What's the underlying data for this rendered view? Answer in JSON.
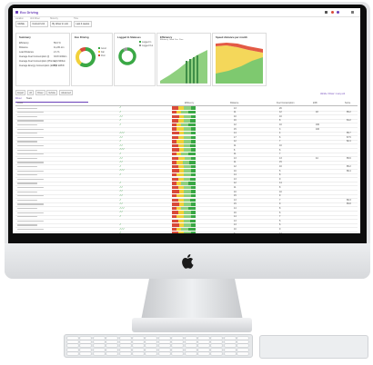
{
  "app": {
    "title": "Eco Driving",
    "topbar_icons": [
      "grid-icon",
      "bell-icon",
      "user-icon",
      "logout-icon"
    ]
  },
  "filters": [
    {
      "label": "Location",
      "value": "Mobile"
    },
    {
      "label": "Unit Driver",
      "value": "Current Unit"
    },
    {
      "label": "Show by",
      "value": "By driver in unit"
    },
    {
      "label": "Time",
      "value": "Last 4 weeks"
    }
  ],
  "summary": {
    "title": "Summary",
    "rows": [
      {
        "label": "Efficiency",
        "value": "59.0 %"
      },
      {
        "label": "Distance",
        "value": "11,231 km"
      },
      {
        "label": "Load Distance",
        "value": "2.1 %"
      },
      {
        "label": "Average Fuel Consumption (l)",
        "value": "33.8 l/100km"
      },
      {
        "label": "Average Fuel Consumption (l/Tonne)",
        "value": "1.0 l/100km"
      },
      {
        "label": "Average Energy Consumption (kWh)",
        "value": "159 kWh/h"
      }
    ]
  },
  "eco_driving_card": {
    "title": "Eco Driving",
    "legend": [
      "Good",
      "Fair",
      "Poor"
    ],
    "share": [
      0.6,
      0.3,
      0.1
    ]
  },
  "logged_in_card": {
    "title": "Logged In Statuses",
    "legend": [
      "Logged In",
      "Logged Out"
    ],
    "share": [
      0.92,
      0.08
    ]
  },
  "efficiency_card": {
    "title": "Efficiency",
    "legend": [
      "Efficiency",
      "Good",
      "Fair",
      "Poor"
    ]
  },
  "speed_card": {
    "title": "Speed distance per month"
  },
  "toolbar": {
    "buttons": [
      "Export",
      "All",
      "Driver",
      "Vehicle",
      "Advanced"
    ],
    "status_note": "Vehicle / Driver: in any unit"
  },
  "tabs": [
    "Driver",
    "Team"
  ],
  "table": {
    "headers": [
      "Driver",
      "Efficiency",
      "Distance",
      "Fuel Consumption",
      "kWh",
      "Score"
    ],
    "rows": [
      {
        "arrows": "↗",
        "distance": "13",
        "fuel": "26",
        "kwh": "",
        "score": "",
        "heat": [
          0.25,
          0.25,
          0.3,
          0.2
        ]
      },
      {
        "arrows": "↗",
        "distance": "11",
        "fuel": "12",
        "kwh": "18",
        "score": "85.2",
        "heat": [
          0.2,
          0.2,
          0.3,
          0.3
        ]
      },
      {
        "arrows": "↗↗",
        "distance": "10",
        "fuel": "10",
        "kwh": "",
        "score": "",
        "heat": [
          0.3,
          0.2,
          0.3,
          0.2
        ]
      },
      {
        "arrows": "↗",
        "distance": "16",
        "fuel": "8",
        "kwh": "",
        "score": "84.2",
        "heat": [
          0.25,
          0.25,
          0.25,
          0.25
        ]
      },
      {
        "arrows": "↗",
        "distance": "12",
        "fuel": "10",
        "kwh": "160",
        "score": "",
        "heat": [
          0.2,
          0.2,
          0.3,
          0.3
        ]
      },
      {
        "arrows": "",
        "distance": "15",
        "fuel": "3",
        "kwh": "100",
        "score": "",
        "heat": [
          0.2,
          0.3,
          0.3,
          0.2
        ]
      },
      {
        "arrows": "↗↗↗",
        "distance": "14",
        "fuel": "4",
        "kwh": "",
        "score": "85.7",
        "heat": [
          0.3,
          0.2,
          0.3,
          0.2
        ]
      },
      {
        "arrows": "↗↗",
        "distance": "17",
        "fuel": "6",
        "kwh": "",
        "score": "87.5",
        "heat": [
          0.25,
          0.25,
          0.3,
          0.2
        ]
      },
      {
        "arrows": "↗",
        "distance": "12",
        "fuel": "7",
        "kwh": "",
        "score": "82.4",
        "heat": [
          0.2,
          0.3,
          0.3,
          0.2
        ]
      },
      {
        "arrows": "↗↗",
        "distance": "11",
        "fuel": "10",
        "kwh": "",
        "score": "",
        "heat": [
          0.25,
          0.25,
          0.25,
          0.25
        ]
      },
      {
        "arrows": "↗↗↗",
        "distance": "8",
        "fuel": "6",
        "kwh": "",
        "score": "",
        "heat": [
          0.3,
          0.2,
          0.3,
          0.2
        ]
      },
      {
        "arrows": "↗",
        "distance": "11",
        "fuel": "7",
        "kwh": "",
        "score": "",
        "heat": [
          0.2,
          0.2,
          0.3,
          0.3
        ]
      },
      {
        "arrows": "↗↗",
        "distance": "13",
        "fuel": "13",
        "kwh": "44",
        "score": "85.6",
        "heat": [
          0.25,
          0.3,
          0.25,
          0.2
        ]
      },
      {
        "arrows": "↗↗",
        "distance": "11",
        "fuel": "15",
        "kwh": "",
        "score": "",
        "heat": [
          0.2,
          0.25,
          0.3,
          0.25
        ]
      },
      {
        "arrows": "↗",
        "distance": "12",
        "fuel": "10",
        "kwh": "",
        "score": "85.2",
        "heat": [
          0.25,
          0.25,
          0.3,
          0.2
        ]
      },
      {
        "arrows": "↗↗↗",
        "distance": "10",
        "fuel": "5",
        "kwh": "",
        "score": "86.4",
        "heat": [
          0.3,
          0.2,
          0.3,
          0.2
        ]
      },
      {
        "arrows": "↗",
        "distance": "14",
        "fuel": "8",
        "kwh": "",
        "score": "",
        "heat": [
          0.2,
          0.3,
          0.3,
          0.2
        ]
      },
      {
        "arrows": "",
        "distance": "13",
        "fuel": "9",
        "kwh": "",
        "score": "",
        "heat": [
          0.25,
          0.25,
          0.25,
          0.25
        ]
      },
      {
        "arrows": "↗",
        "distance": "12",
        "fuel": "14",
        "kwh": "",
        "score": "",
        "heat": [
          0.2,
          0.2,
          0.3,
          0.3
        ]
      },
      {
        "arrows": "↗↗",
        "distance": "11",
        "fuel": "8",
        "kwh": "",
        "score": "",
        "heat": [
          0.25,
          0.25,
          0.3,
          0.2
        ]
      },
      {
        "arrows": "↗↗",
        "distance": "10",
        "fuel": "10",
        "kwh": "",
        "score": "",
        "heat": [
          0.3,
          0.2,
          0.3,
          0.2
        ]
      },
      {
        "arrows": "↗↗",
        "distance": "15",
        "fuel": "9",
        "kwh": "",
        "score": "",
        "heat": [
          0.2,
          0.3,
          0.3,
          0.2
        ]
      },
      {
        "arrows": "↗",
        "distance": "13",
        "fuel": "7",
        "kwh": "",
        "score": "86.3",
        "heat": [
          0.25,
          0.25,
          0.25,
          0.25
        ]
      },
      {
        "arrows": "↗↗",
        "distance": "15",
        "fuel": "9",
        "kwh": "",
        "score": "85.8",
        "heat": [
          0.3,
          0.2,
          0.3,
          0.2
        ]
      },
      {
        "arrows": "↗↗↗",
        "distance": "14",
        "fuel": "8",
        "kwh": "",
        "score": "",
        "heat": [
          0.2,
          0.2,
          0.3,
          0.3
        ]
      },
      {
        "arrows": "↗↗",
        "distance": "16",
        "fuel": "6",
        "kwh": "",
        "score": "",
        "heat": [
          0.25,
          0.25,
          0.3,
          0.2
        ]
      },
      {
        "arrows": "↗",
        "distance": "14",
        "fuel": "7",
        "kwh": "",
        "score": "",
        "heat": [
          0.2,
          0.3,
          0.3,
          0.2
        ]
      },
      {
        "arrows": "",
        "distance": "13",
        "fuel": "5",
        "kwh": "",
        "score": "",
        "heat": [
          0.25,
          0.25,
          0.25,
          0.25
        ]
      },
      {
        "arrows": "↗",
        "distance": "13",
        "fuel": "6",
        "kwh": "",
        "score": "",
        "heat": [
          0.3,
          0.2,
          0.3,
          0.2
        ]
      },
      {
        "arrows": "↗↗↗",
        "distance": "10",
        "fuel": "9",
        "kwh": "",
        "score": "",
        "heat": [
          0.2,
          0.2,
          0.3,
          0.3
        ]
      },
      {
        "arrows": "↗",
        "distance": "9",
        "fuel": "12",
        "kwh": "",
        "score": "",
        "heat": [
          0.25,
          0.25,
          0.3,
          0.2
        ]
      }
    ]
  },
  "colors": {
    "brand": "#6a3fb8",
    "good": "#3aa845",
    "fair": "#f2d13a",
    "poor": "#d94a3a",
    "area_green": "#7ec96f",
    "area_yellow": "#f4d75a"
  }
}
